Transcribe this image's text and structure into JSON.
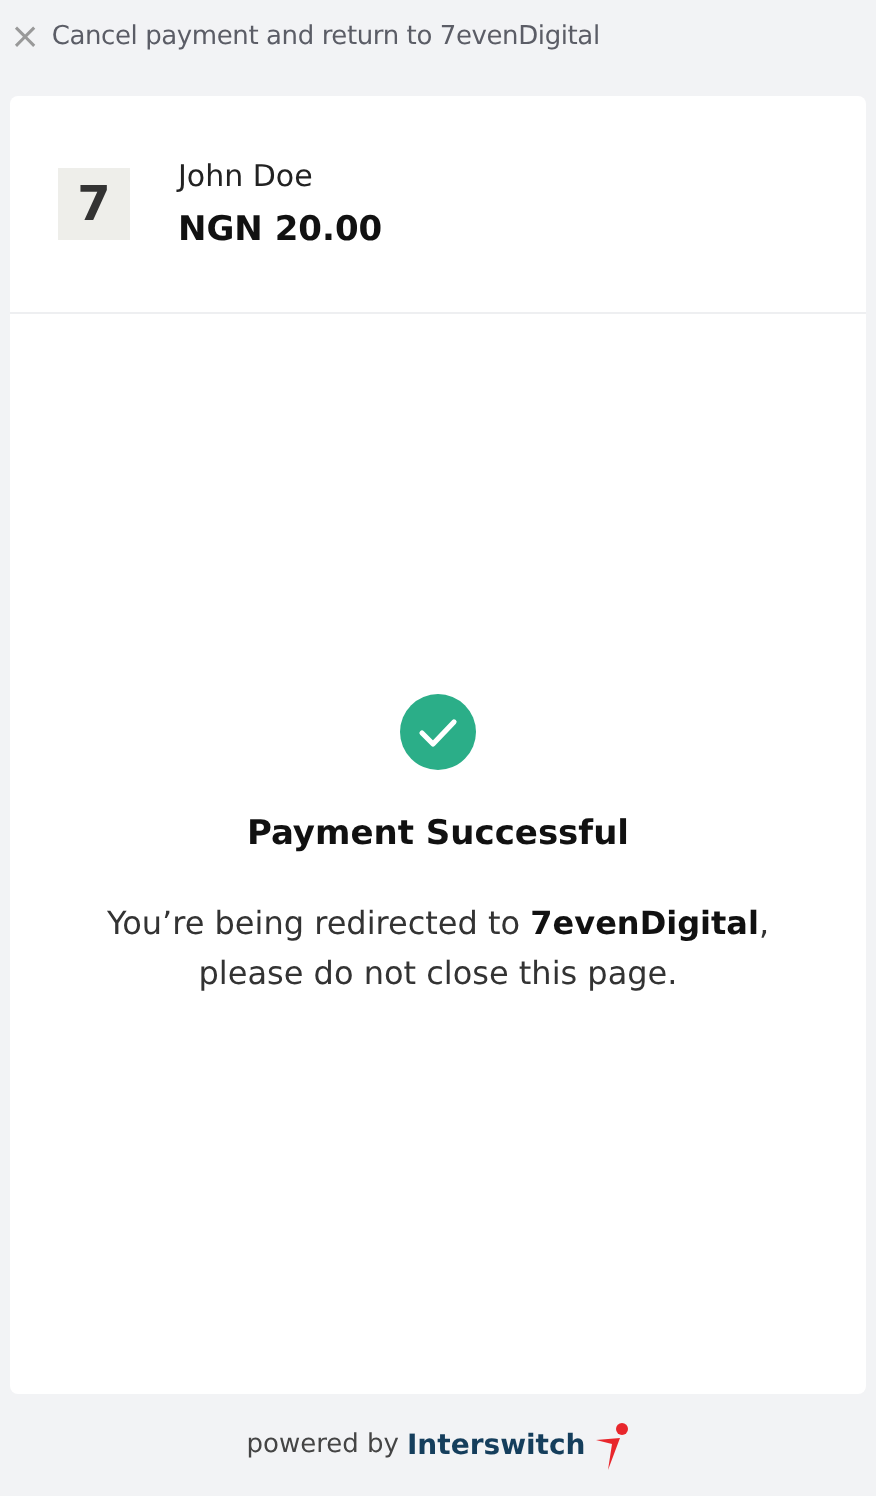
{
  "cancel_link": {
    "icon": "×",
    "label": "Cancel payment and return to 7evenDigital"
  },
  "merchant": {
    "logo": "7",
    "customer": "John Doe",
    "amount": "NGN 20.00"
  },
  "status": {
    "kind": "success",
    "title": "Payment Successful",
    "message": "You’re being redirected to **7evenDigital**, please do not close this page."
  },
  "footer": {
    "prefix": "powered by",
    "brand": "Interswitch"
  }
}
